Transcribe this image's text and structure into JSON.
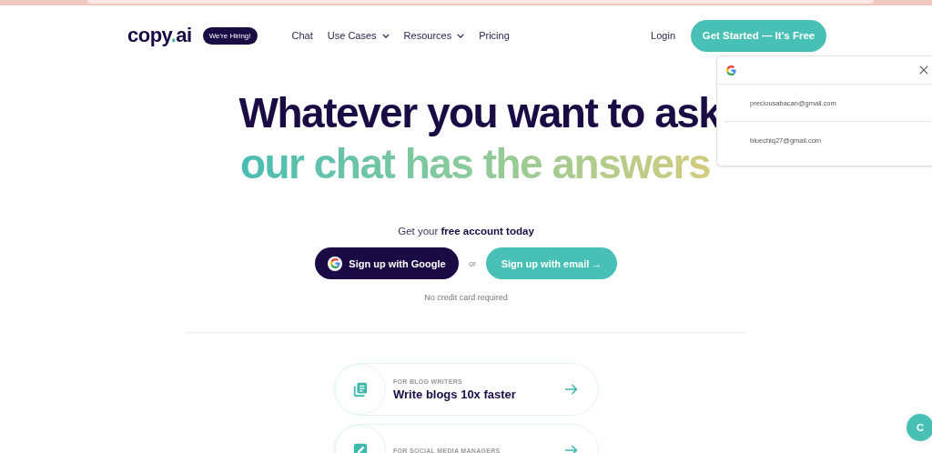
{
  "header": {
    "logo": "copy.ai",
    "hiring_badge": "We're Hiring!",
    "nav": [
      {
        "label": "Chat",
        "dropdown": false
      },
      {
        "label": "Use Cases",
        "dropdown": true
      },
      {
        "label": "Resources",
        "dropdown": true
      },
      {
        "label": "Pricing",
        "dropdown": false
      }
    ],
    "login": "Login",
    "cta": "Get Started — It's Free"
  },
  "google_popup": {
    "accounts": [
      "preciousabacan@gmail.com",
      "bluechiq27@gmail.com"
    ]
  },
  "hero": {
    "line_1": "Whatever you want to ask",
    "line_2": "our chat has the answers",
    "subtitle": "Get your **free account today**",
    "google_button": "Sign up with Google",
    "or": "or",
    "email_button": "Sign up with email →",
    "note": "No credit card required"
  },
  "cards": [
    {
      "eyebrow": "FOR BLOG WRITERS",
      "title": "Write blogs 10x faster",
      "kind": "blog"
    },
    {
      "eyebrow": "FOR SOCIAL MEDIA MANAGERS",
      "kind": "pen"
    }
  ],
  "chat_bubble": "C"
}
